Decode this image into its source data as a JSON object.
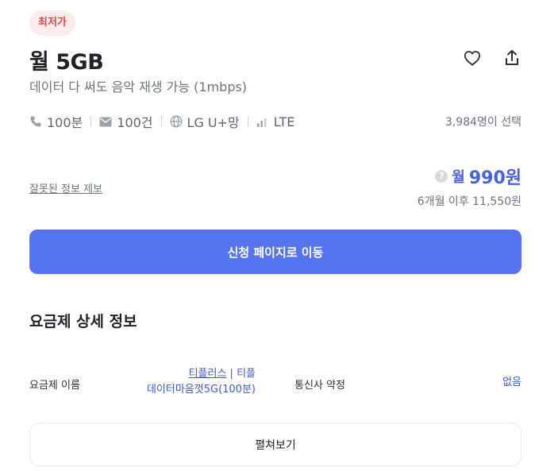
{
  "badge": "최저가",
  "plan": {
    "title": "월 5GB",
    "subtitle": "데이터 다 써도 음악 재생 가능 (1mbps)"
  },
  "specs": {
    "call": "100분",
    "sms": "100건",
    "network": "LG U+망",
    "type": "LTE",
    "chosen_count": "3,984명이 선택"
  },
  "report_link": "잘못된 정보 제보",
  "price": {
    "help": "?",
    "prefix": "월",
    "value": "990원",
    "after": "6개월 이후 11,550원"
  },
  "cta_label": "신청 페이지로 이동",
  "details": {
    "title": "요금제 상세 정보",
    "rows": [
      {
        "label": "요금제 이름",
        "value_link": "티플러스",
        "value_rest1": " | 티플",
        "value_line2": "데이터마음껏5G(100분)"
      },
      {
        "label": "통신사 약정",
        "value": "없음"
      }
    ]
  },
  "expand_label": "펼쳐보기",
  "colors": {
    "accent": "#5673f0",
    "price": "#4a62d9",
    "badge_bg": "#fdecec",
    "badge_text": "#e5484d"
  },
  "icons": [
    "heart-icon",
    "share-icon",
    "phone-icon",
    "mail-icon",
    "globe-icon",
    "signal-icon",
    "help-icon"
  ]
}
